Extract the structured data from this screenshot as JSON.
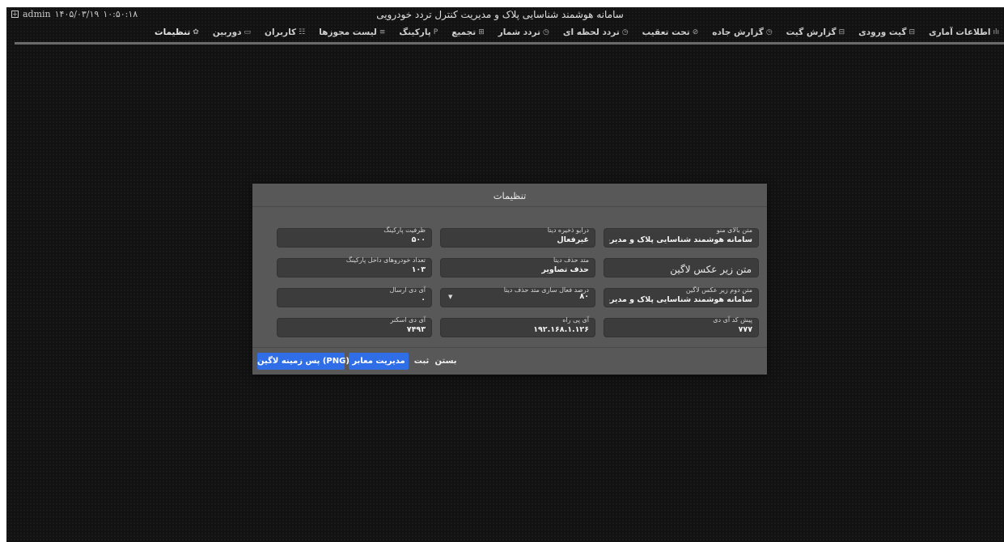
{
  "system": {
    "user": "admin",
    "date": "۱۴۰۵/۰۳/۱۹",
    "time": "۱۰:۵۰:۱۸"
  },
  "app": {
    "title": "سامانه هوشمند شناسایی پلاک و مدیریت کنترل تردد خودرویی"
  },
  "nav": {
    "items": [
      {
        "label": "اطلاعات آماری",
        "icon": "ılı"
      },
      {
        "label": "گیت ورودی",
        "icon": "⊟"
      },
      {
        "label": "گزارش گیت",
        "icon": "⊟"
      },
      {
        "label": "گزارش جاده",
        "icon": "◷"
      },
      {
        "label": "تحت تعقیب",
        "icon": "⊘"
      },
      {
        "label": "تردد لحظه ای",
        "icon": "◷"
      },
      {
        "label": "تردد شمار",
        "icon": "◷"
      },
      {
        "label": "تجمیع",
        "icon": "⊞"
      },
      {
        "label": "پارکینگ",
        "icon": "P"
      },
      {
        "label": "لیست مجوزها",
        "icon": "≡"
      },
      {
        "label": "کاربران",
        "icon": "☷"
      },
      {
        "label": "دوربین",
        "icon": "▭"
      },
      {
        "label": "تنظیمات",
        "icon": "✿"
      }
    ]
  },
  "modal": {
    "title": "تنظیمات",
    "fields": {
      "menu_top_text": {
        "label": "متن بالای منو",
        "value": "سامانه هوشمند شناسایی پلاک و مدیریت کنترل تردد خو"
      },
      "data_drive": {
        "label": "درایو ذخیره دیتا",
        "value": "غیرفعال"
      },
      "parking_capacity": {
        "label": "ظرفیت پارکینگ",
        "value": "۵۰۰"
      },
      "login_image_text": {
        "placeholder": "متن زیر عکس لاگین"
      },
      "data_delete_method": {
        "label": "متد حذف دیتا",
        "value": "حذف تصاویر"
      },
      "vehicles_inside": {
        "label": "تعداد خودروهای داخل پارکینگ",
        "value": "۱۰۳"
      },
      "login_image_text2": {
        "label": "متن دوم زیر عکس لاگین",
        "value": "سامانه هوشمند شناسایی پلاک و مدیریت کنترل تردد خو"
      },
      "delete_activation_percent": {
        "label": "درصد فعال سازی متد حذف دیتا",
        "value": "۸۰"
      },
      "send_id": {
        "label": "آی دی ارسال",
        "value": "۰"
      },
      "id_prefix": {
        "label": "پیش کد آی دی",
        "value": "۷۷۷"
      },
      "rah_ip": {
        "label": "آی پی راه",
        "value": "۱۹۲.۱۶۸.۱.۱۲۶"
      },
      "scanner_id": {
        "label": "آی دی اسکنر",
        "value": "۷۴۹۳"
      }
    },
    "buttons": {
      "close": "بستن",
      "save": "ثبت",
      "gateway_management": "مدیریت معابر",
      "login_background": "پس زمینه لاگین (PNG)"
    }
  },
  "colors": {
    "background": "#121212",
    "modal": "#585858",
    "field": "#3c3c3c",
    "primary_button": "#2f6ee6"
  }
}
